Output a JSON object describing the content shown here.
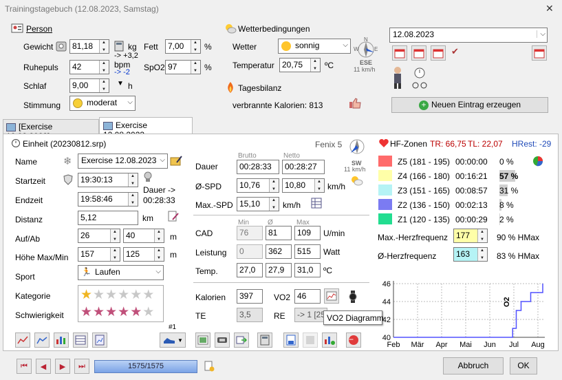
{
  "window": {
    "title": "Trainingstagebuch (12.08.2023, Samstag)",
    "close": "✕"
  },
  "person": {
    "header": "Person",
    "gewicht_label": "Gewicht",
    "gewicht": "81,18",
    "gewicht_unit": "kg",
    "gewicht_delta": "-> +3,2",
    "fett_label": "Fett",
    "fett": "7,00",
    "fett_unit": "%",
    "ruhepuls_label": "Ruhepuls",
    "ruhepuls": "42",
    "ruhepuls_unit": "bpm",
    "ruhepuls_delta": "-> -2",
    "spo2_label": "SpO2",
    "spo2": "97",
    "spo2_unit": "%",
    "schlaf_label": "Schlaf",
    "schlaf": "9,00",
    "schlaf_unit": "h",
    "stimmung_label": "Stimmung",
    "stimmung": "moderat"
  },
  "weather": {
    "header": "Wetterbedingungen",
    "wetter_label": "Wetter",
    "wetter": "sonnig",
    "temp_label": "Temperatur",
    "temp": "20,75",
    "temp_unit": "ºC",
    "wind_dir": "ESE",
    "wind_speed": "11 km/h",
    "compass_n": "N",
    "compass_w": "W",
    "compass_e": "E",
    "compass_s": "S"
  },
  "tagesbilanz": {
    "header": "Tagesbilanz",
    "kalorien": "verbrannte Kalorien: 813"
  },
  "date": {
    "value": "12.08.2023",
    "new_entry": "Neuen Eintrag erzeugen"
  },
  "tabs": [
    {
      "label": "[Exercise 12.08.2023]"
    },
    {
      "label": "Exercise 12.08.2023"
    }
  ],
  "unit": {
    "header": "Einheit (20230812.srp)",
    "device": "Fenix 5",
    "wind_dir": "SW",
    "wind_speed": "11 km/h",
    "name_label": "Name",
    "name": "Exercise 12.08.2023",
    "startzeit_label": "Startzeit",
    "startzeit": "19:30:13",
    "endzeit_label": "Endzeit",
    "endzeit": "19:58:46",
    "dauer_note": "Dauer ->",
    "dauer_note_val": "00:28:33",
    "distanz_label": "Distanz",
    "distanz": "5,12",
    "distanz_unit": "km",
    "aufab_label": "Auf/Ab",
    "auf": "26",
    "ab": "40",
    "aufab_unit": "m",
    "hoehe_label": "Höhe Max/Min",
    "hoehe_max": "157",
    "hoehe_min": "125",
    "hoehe_unit": "m",
    "sport_label": "Sport",
    "sport": "Laufen",
    "kategorie_label": "Kategorie",
    "schwierigkeit_label": "Schwierigkeit",
    "kategorie_rating": 1,
    "schwierigkeit_rating": 5,
    "gear_number": "#1"
  },
  "metrics": {
    "brutto": "Brutto",
    "netto": "Netto",
    "dauer_label": "Dauer",
    "dauer_brutto": "00:28:33",
    "dauer_netto": "00:28:27",
    "spd_label": "Ø-SPD",
    "spd_brutto": "10,76",
    "spd_netto": "10,80",
    "spd_unit": "km/h",
    "maxspd_label": "Max.-SPD",
    "maxspd": "15,10",
    "maxspd_unit": "km/h",
    "min": "Min",
    "avg": "Ø",
    "max": "Max",
    "cad_label": "CAD",
    "cad_min": "76",
    "cad_avg": "81",
    "cad_max": "109",
    "cad_unit": "U/min",
    "leistung_label": "Leistung",
    "leistung_min": "0",
    "leistung_avg": "362",
    "leistung_max": "515",
    "leistung_unit": "Watt",
    "temp_label": "Temp.",
    "temp_min": "27,0",
    "temp_avg": "27,9",
    "temp_max": "31,0",
    "temp_unit": "ºC",
    "kalorien_label": "Kalorien",
    "kalorien": "397",
    "vo2_label": "VO2",
    "vo2": "46",
    "te_label": "TE",
    "te": "3,5",
    "re_label": "RE",
    "re": "-> 1 [25"
  },
  "tooltip": "VO2 Diagramm",
  "hr": {
    "header": "HF-Zonen",
    "tr": "TR: 66,75",
    "tl": "TL: 22,07",
    "hrest": "HRest: -29",
    "zones": [
      {
        "label": "Z5 (181 - 195)",
        "time": "00:00:00",
        "pct": "0 %",
        "color": "#ff6b6b",
        "fill": 0.0
      },
      {
        "label": "Z4 (166 - 180)",
        "time": "00:16:21",
        "pct": "57 %",
        "color": "#ffffa8",
        "fill": 0.57
      },
      {
        "label": "Z3 (151 - 165)",
        "time": "00:08:57",
        "pct": "31 %",
        "color": "#b5f3f5",
        "fill": 0.31
      },
      {
        "label": "Z2 (136 - 150)",
        "time": "00:02:13",
        "pct": "8 %",
        "color": "#7b7bf2",
        "fill": 0.08
      },
      {
        "label": "Z1 (120 - 135)",
        "time": "00:00:29",
        "pct": "2 %",
        "color": "#22dd90",
        "fill": 0.02
      }
    ],
    "maxhf_label": "Max.-Herzfrequenz",
    "maxhf": "177",
    "maxhf_pct": "90 % HMax",
    "avghf_label": "Ø-Herzfrequenz",
    "avghf": "163",
    "avghf_pct": "83 % HMax"
  },
  "chart_data": {
    "type": "line",
    "x": [
      "Feb",
      "Mär",
      "Apr",
      "Mai",
      "Jun",
      "Jul",
      "Aug"
    ],
    "yticks": [
      40,
      42,
      44,
      46
    ],
    "ylim": [
      40,
      46
    ],
    "ylabel_partial": "O2",
    "series": [
      {
        "values": [
          40,
          40,
          40,
          40,
          40,
          41,
          43,
          44,
          45,
          46
        ],
        "x": [
          0,
          1,
          2,
          3,
          4.8,
          4.95,
          5.1,
          5.3,
          5.7,
          6.2
        ]
      }
    ],
    "line_color": "#5050ff"
  },
  "nav": {
    "counter": "1575/1575",
    "cancel": "Abbruch",
    "ok": "OK"
  }
}
